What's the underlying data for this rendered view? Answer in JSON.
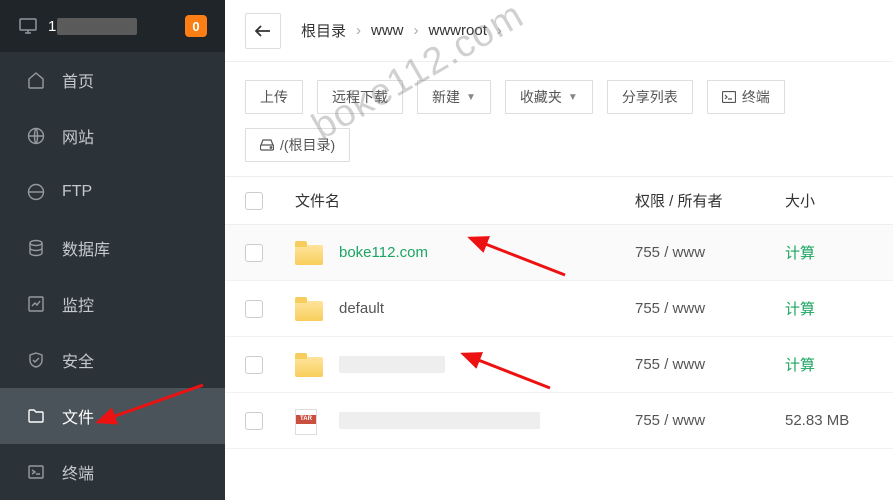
{
  "header": {
    "ip_prefix": "1",
    "badge": "0"
  },
  "sidebar": {
    "items": [
      {
        "label": "首页"
      },
      {
        "label": "网站"
      },
      {
        "label": "FTP"
      },
      {
        "label": "数据库"
      },
      {
        "label": "监控"
      },
      {
        "label": "安全"
      },
      {
        "label": "文件"
      },
      {
        "label": "终端"
      }
    ]
  },
  "breadcrumbs": {
    "root": "根目录",
    "p1": "www",
    "p2": "wwwroot"
  },
  "toolbar": {
    "upload": "上传",
    "remote": "远程下载",
    "new": "新建",
    "fav": "收藏夹",
    "share": "分享列表",
    "terminal": "终端",
    "diskroot": "/(根目录)"
  },
  "columns": {
    "name": "文件名",
    "perm": "权限 / 所有者",
    "size": "大小"
  },
  "files": [
    {
      "name": "boke112.com",
      "perm": "755 / www",
      "size": "计算",
      "type": "folder",
      "hl": true,
      "green_name": true,
      "green_size": true
    },
    {
      "name": "default",
      "perm": "755 / www",
      "size": "计算",
      "type": "folder",
      "green_size": true
    },
    {
      "name": "w~~~~~~~~~g",
      "perm": "755 / www",
      "size": "计算",
      "type": "folder",
      "redact": true,
      "green_size": true
    },
    {
      "name": "~~~~~~~~~~~~~~~~~~~~~~",
      "perm": "755 / www",
      "size": "52.83 MB",
      "type": "tar",
      "redact": true
    }
  ],
  "watermark": "boke112.com"
}
